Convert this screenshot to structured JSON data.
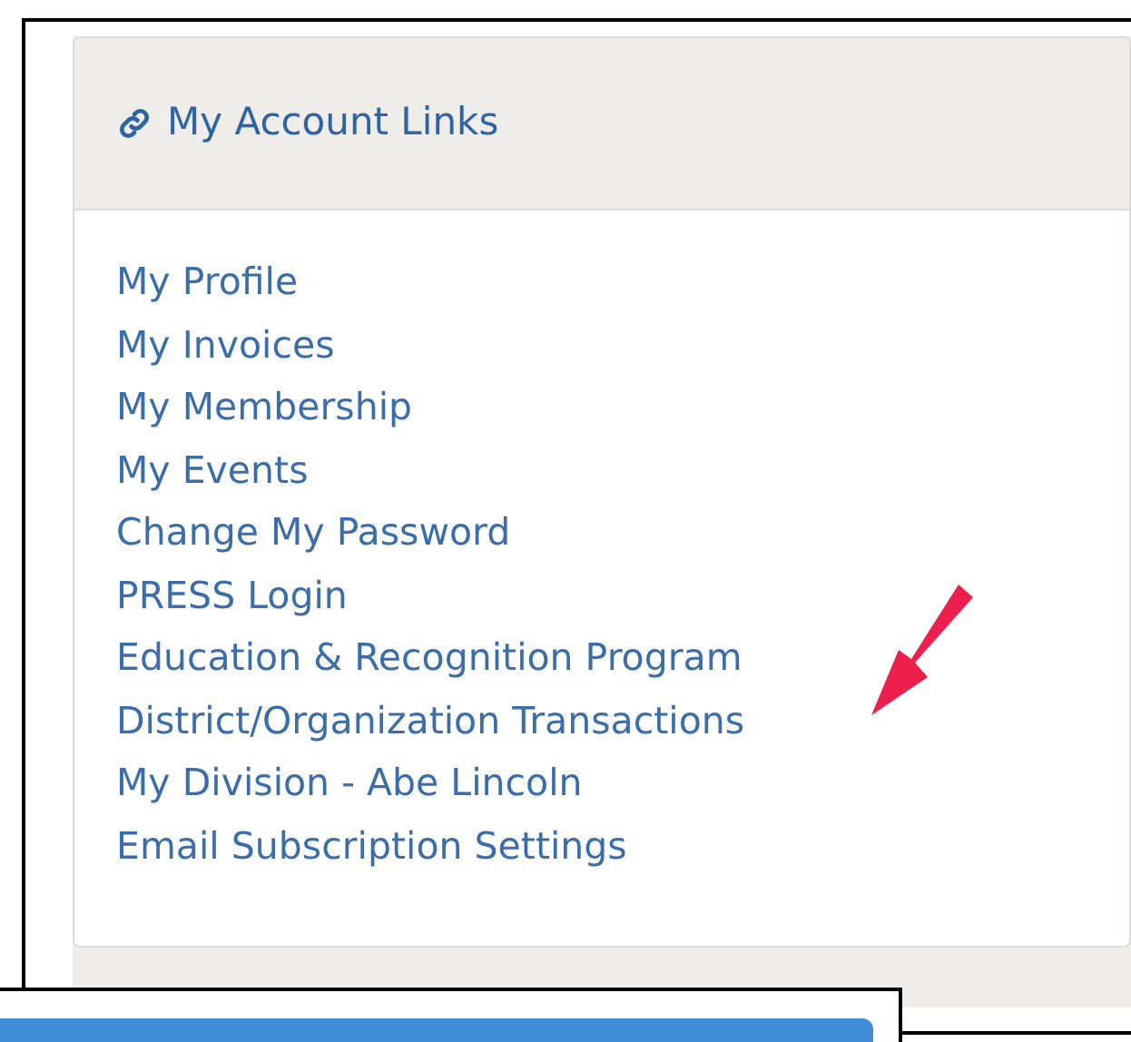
{
  "panel": {
    "title": "My Account Links"
  },
  "links": [
    {
      "label": "My Profile"
    },
    {
      "label": "My Invoices"
    },
    {
      "label": "My Membership"
    },
    {
      "label": "My Events"
    },
    {
      "label": "Change My Password"
    },
    {
      "label": "PRESS Login"
    },
    {
      "label": "Education & Recognition Program"
    },
    {
      "label": "District/Organization Transactions"
    },
    {
      "label": "My Division - Abe Lincoln"
    },
    {
      "label": "Email Subscription Settings"
    }
  ]
}
